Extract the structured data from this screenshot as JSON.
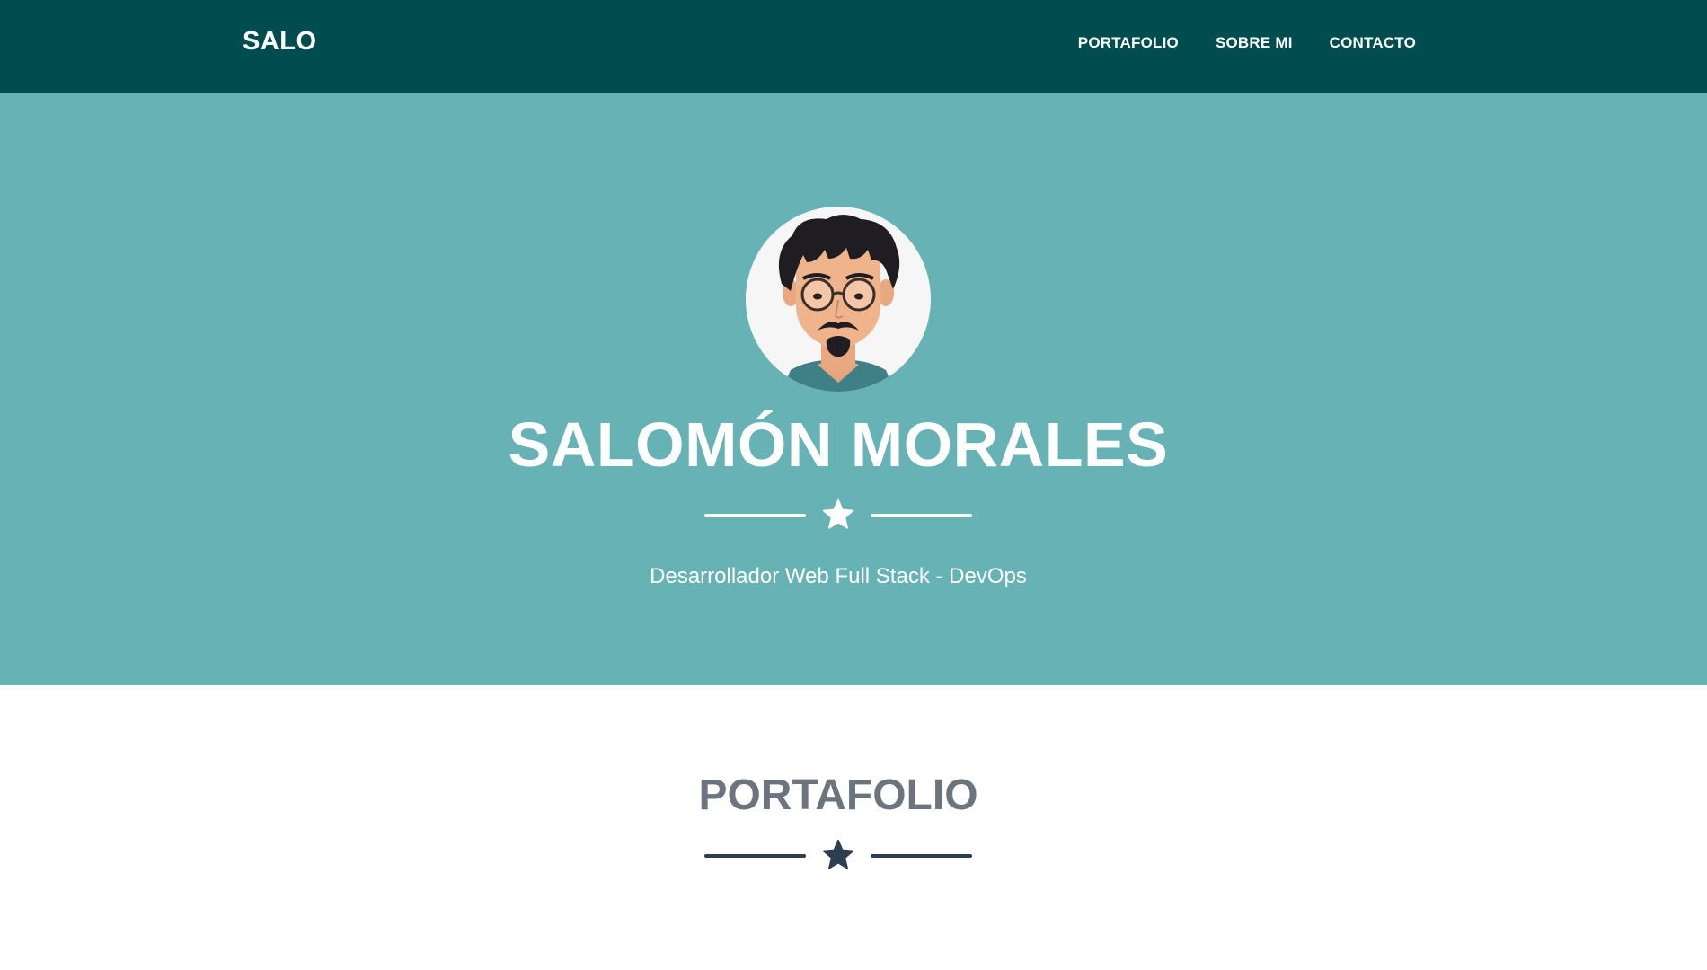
{
  "navbar": {
    "brand": "SALO",
    "links": [
      "PORTAFOLIO",
      "SOBRE MI",
      "CONTACTO"
    ]
  },
  "hero": {
    "avatar_icon": "avatar-cartoon-portrait",
    "name": "SALOMÓN MORALES",
    "divider_icon": "star-icon",
    "subtitle": "Desarrollador Web Full Stack - DevOps"
  },
  "portfolio": {
    "title": "PORTAFOLIO",
    "divider_icon": "star-icon"
  },
  "colors": {
    "navbar_bg": "#004c4e",
    "hero_bg": "#67b2b4",
    "hero_text": "#ffffff",
    "section_title": "#6c757d",
    "section_divider": "#2c3e50"
  }
}
